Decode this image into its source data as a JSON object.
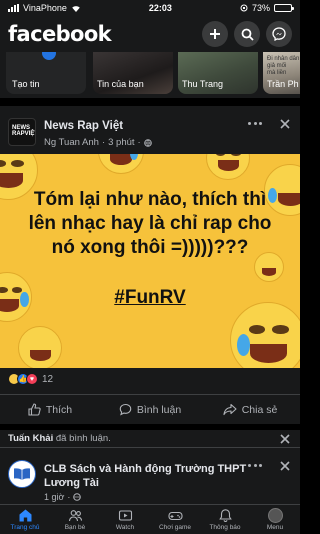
{
  "status_bar": {
    "carrier": "VinaPhone",
    "time": "22:03",
    "battery": "73%",
    "battery_level": 0.73
  },
  "header": {
    "logo": "facebook"
  },
  "stories": {
    "items": [
      {
        "label": "Tạo tin"
      },
      {
        "label": "Tin của bạn"
      },
      {
        "label": "Thu Trang"
      },
      {
        "label": "Trần Ph",
        "thumb_text": "Đi nhân dân\ngiả mối\nmà liền"
      }
    ]
  },
  "post": {
    "page_name": "News Rap Việt",
    "avatar_text": "NEWS\nRAPVIỆT",
    "author": "Ng Tuan Anh",
    "time": "3 phút",
    "image_text": "Tóm lại như nào, thích thì lên nhạc hay là chỉ rap cho nó xong thôi =)))))???",
    "image_tag": "#FunRV",
    "reaction_count": "12",
    "actions": {
      "like": "Thích",
      "comment": "Bình luận",
      "share": "Chia sẻ"
    }
  },
  "notification": {
    "actor": "Tuấn Khải",
    "action": "đã bình luận."
  },
  "post2": {
    "page_name": "CLB Sách và Hành động Trường THPT Lương Tài",
    "time": "1 giờ"
  },
  "bottom_nav": [
    {
      "label": "Trang chủ",
      "icon": "home-icon",
      "active": true
    },
    {
      "label": "Bạn bè",
      "icon": "friends-icon"
    },
    {
      "label": "Watch",
      "icon": "watch-icon"
    },
    {
      "label": "Chơi game",
      "icon": "gaming-icon"
    },
    {
      "label": "Thông báo",
      "icon": "bell-icon"
    },
    {
      "label": "Menu",
      "icon": "menu-avatar"
    }
  ],
  "colors": {
    "accent": "#2d88ff",
    "image_bg": "#f6c23b",
    "surface": "#18191a"
  }
}
